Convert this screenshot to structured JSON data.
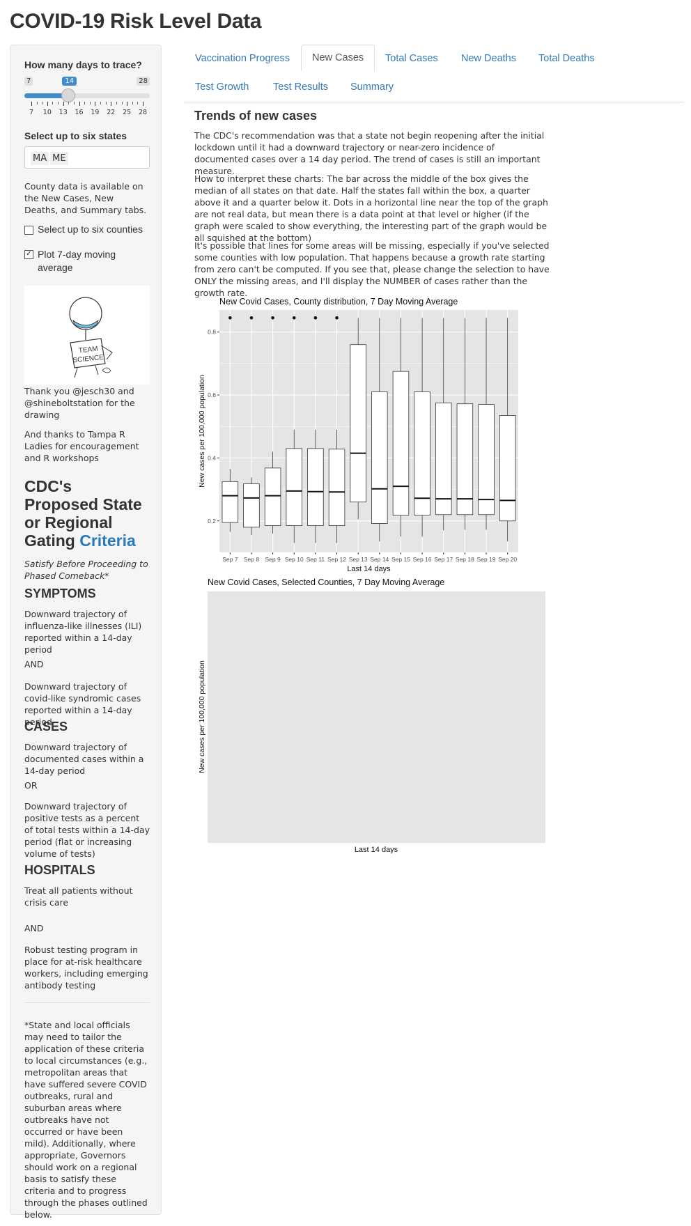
{
  "app_title": "COVID-19 Risk Level Data",
  "sidebar": {
    "days_label": "How many days to trace?",
    "slider": {
      "min": 7,
      "max": 28,
      "value": 14,
      "ticks": [
        "7",
        "10",
        "13",
        "16",
        "19",
        "22",
        "25",
        "28"
      ]
    },
    "states_label": "Select up to six states",
    "selected_states": [
      "MA",
      "ME"
    ],
    "county_note": "County data is available on the New Cases, New Deaths, and Summary tabs.",
    "counties_checkbox": {
      "label": "Select up to six counties",
      "checked": false
    },
    "moving_avg_checkbox": {
      "label": "Plot 7-day moving average",
      "checked": true
    },
    "drawing_text": {
      "line1": "TEAM",
      "line2": "SCIENCE"
    },
    "thanks1": "Thank you @jesch30 and @shineboltstation for the drawing",
    "thanks2": "And thanks to Tampa R Ladies for encouragement and R workshops",
    "cdc_title_plain": "CDC's Proposed State or Regional Gating",
    "cdc_title_link": "Criteria",
    "satisfy_note": "Satisfy Before Proceeding to Phased Comeback*",
    "symptoms": {
      "heading": "SYMPTOMS",
      "item1": "Downward trajectory of influenza-like illnesses (ILI) reported within a 14-day period",
      "joiner": "AND",
      "item2": "Downward trajectory of covid-like syndromic cases reported within a 14-day period"
    },
    "cases": {
      "heading": "CASES",
      "item1": "Downward trajectory of documented cases within a 14-day period",
      "joiner": "OR",
      "item2": "Downward trajectory of positive tests as a percent of total tests within a 14-day period (flat or increasing volume of tests)"
    },
    "hospitals": {
      "heading": "HOSPITALS",
      "item1": "Treat all patients without crisis care",
      "joiner": "AND",
      "item2": "Robust testing program in place for at-risk healthcare workers, including emerging antibody testing"
    },
    "footnote": "*State and local officials may need to tailor the application of these criteria to local circumstances (e.g., metropolitan areas that have suffered severe COVID outbreaks, rural and suburban areas where outbreaks have not occurred or have been mild). Additionally, where appropriate, Governors should work on a regional basis to satisfy these criteria and to progress through the phases outlined below."
  },
  "tabs": [
    {
      "label": "Vaccination Progress",
      "active": false
    },
    {
      "label": "New Cases",
      "active": true
    },
    {
      "label": "Total Cases",
      "active": false
    },
    {
      "label": "New Deaths",
      "active": false
    },
    {
      "label": "Total Deaths",
      "active": false
    },
    {
      "label": "Test Growth",
      "active": false
    },
    {
      "label": "Test Results",
      "active": false
    },
    {
      "label": "Summary",
      "active": false
    }
  ],
  "main": {
    "heading": "Trends of new cases",
    "para1": "The CDC's recommendation was that a state not begin reopening after the initial lockdown until it had a downward trajectory or near-zero incidence of documented cases over a 14 day period. The trend of cases is still an important measure.",
    "para2": "How to interpret these charts: The bar across the middle of the box gives the median of all states on that date. Half the states fall within the box, a quarter above it and a quarter below it. Dots in a horizontal line near the top of the graph are not real data, but mean there is a data point at that level or higher (if the graph were scaled to show everything, the interesting part of the graph would be all squished at the bottom)",
    "para3": "It's possible that lines for some areas will be missing, especially if you've selected some counties with low population. That happens because a growth rate starting from zero can't be computed. If you see that, please change the selection to have ONLY the missing areas, and I'll display the NUMBER of cases rather than the growth rate."
  },
  "colors": {
    "link": "#337ab7",
    "panel": "#e5e5e5",
    "accent": "#428bca"
  },
  "chart_data": [
    {
      "type": "box",
      "title": "New Covid Cases, County distribution, 7 Day Moving Average",
      "xlabel": "Last 14 days",
      "ylabel": "New cases per 100,000 population",
      "ylim": [
        0.1,
        0.87
      ],
      "yticks": [
        "0.2",
        "0.4",
        "0.6",
        "0.8"
      ],
      "grid": true,
      "categories": [
        "Sep 7",
        "Sep 8",
        "Sep 9",
        "Sep 10",
        "Sep 11",
        "Sep 12",
        "Sep 13",
        "Sep 14",
        "Sep 15",
        "Sep 16",
        "Sep 17",
        "Sep 18",
        "Sep 19",
        "Sep 20"
      ],
      "boxes": [
        {
          "wlo": 0.165,
          "q1": 0.195,
          "med": 0.28,
          "q3": 0.325,
          "whi": 0.365,
          "outlier": 0.845
        },
        {
          "wlo": 0.155,
          "q1": 0.18,
          "med": 0.273,
          "q3": 0.318,
          "whi": 0.338,
          "outlier": 0.845
        },
        {
          "wlo": 0.16,
          "q1": 0.185,
          "med": 0.28,
          "q3": 0.368,
          "whi": 0.42,
          "outlier": 0.845
        },
        {
          "wlo": 0.13,
          "q1": 0.185,
          "med": 0.295,
          "q3": 0.43,
          "whi": 0.49,
          "outlier": 0.845
        },
        {
          "wlo": 0.13,
          "q1": 0.185,
          "med": 0.293,
          "q3": 0.43,
          "whi": 0.49,
          "outlier": 0.845
        },
        {
          "wlo": 0.13,
          "q1": 0.185,
          "med": 0.292,
          "q3": 0.428,
          "whi": 0.49,
          "outlier": 0.845
        },
        {
          "wlo": 0.205,
          "q1": 0.26,
          "med": 0.415,
          "q3": 0.76,
          "whi": 0.845,
          "outlier": null
        },
        {
          "wlo": 0.135,
          "q1": 0.192,
          "med": 0.302,
          "q3": 0.61,
          "whi": 0.845,
          "outlier": null
        },
        {
          "wlo": 0.15,
          "q1": 0.218,
          "med": 0.31,
          "q3": 0.675,
          "whi": 0.845,
          "outlier": null
        },
        {
          "wlo": 0.15,
          "q1": 0.218,
          "med": 0.272,
          "q3": 0.61,
          "whi": 0.845,
          "outlier": null
        },
        {
          "wlo": 0.17,
          "q1": 0.22,
          "med": 0.27,
          "q3": 0.575,
          "whi": 0.845,
          "outlier": null
        },
        {
          "wlo": 0.172,
          "q1": 0.22,
          "med": 0.27,
          "q3": 0.572,
          "whi": 0.845,
          "outlier": null
        },
        {
          "wlo": 0.172,
          "q1": 0.22,
          "med": 0.268,
          "q3": 0.57,
          "whi": 0.845,
          "outlier": null
        },
        {
          "wlo": 0.135,
          "q1": 0.2,
          "med": 0.265,
          "q3": 0.535,
          "whi": 0.845,
          "outlier": null
        }
      ]
    },
    {
      "type": "line",
      "title": "New Covid Cases, Selected Counties, 7 Day Moving Average",
      "xlabel": "Last 14 days",
      "ylabel": "New cases per 100,000 population",
      "series": []
    }
  ]
}
